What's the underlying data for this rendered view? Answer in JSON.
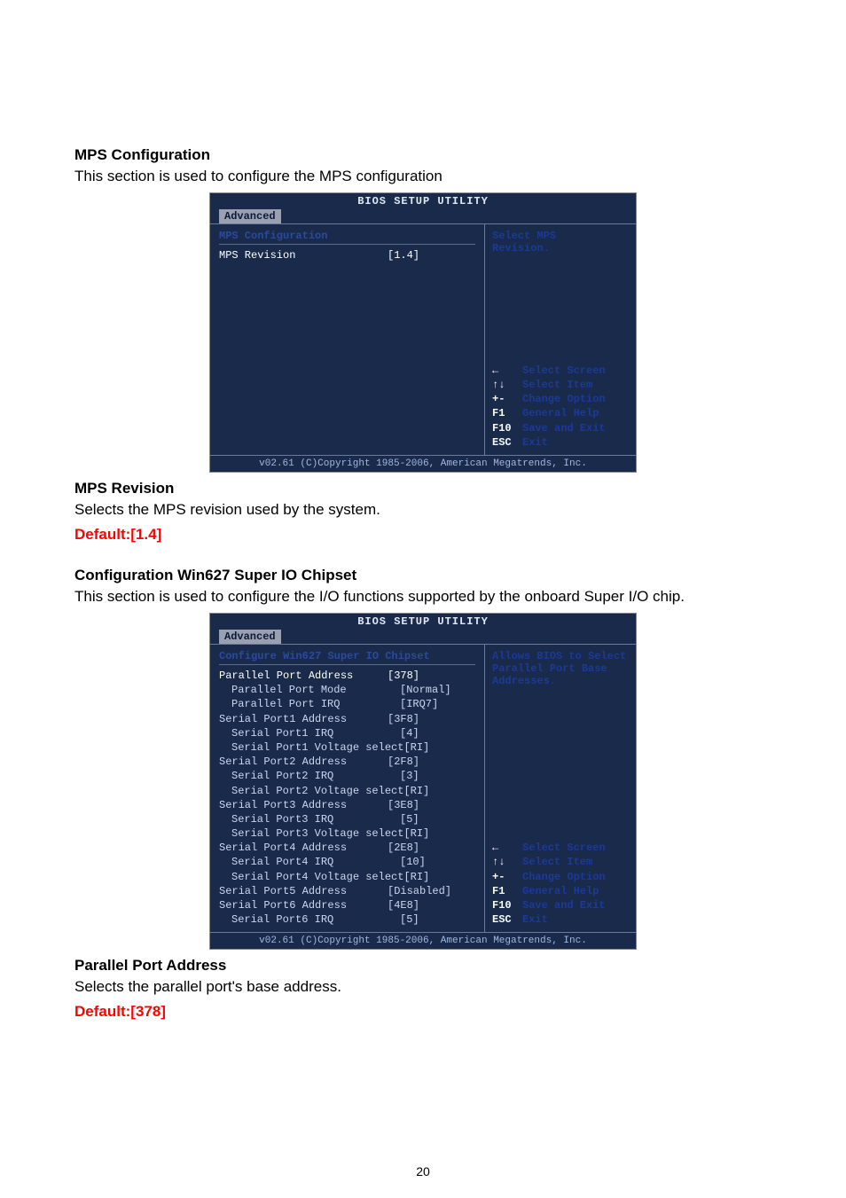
{
  "sec1": {
    "heading": "MPS Configuration",
    "intro": "This section is used to configure the MPS configuration",
    "subheading": "MPS Revision",
    "subtext": "Selects the MPS revision used by the system.",
    "default": "Default:[1.4]"
  },
  "sec2": {
    "heading": "Configuration Win627 Super IO Chipset",
    "intro": "This section is used to configure the I/O functions supported by the onboard Super I/O chip.",
    "subheading": "Parallel Port Address",
    "subtext": "Selects the parallel port's base address.",
    "default": "Default:[378]"
  },
  "bios_common": {
    "title": "BIOS SETUP UTILITY",
    "tab": "Advanced",
    "footer": "v02.61 (C)Copyright 1985-2006, American Megatrends, Inc.",
    "keys": [
      {
        "k": "←",
        "d": "Select Screen"
      },
      {
        "k": "↑↓",
        "d": "Select Item"
      },
      {
        "k": "+-",
        "d": "Change Option"
      },
      {
        "k": "F1",
        "d": "General Help"
      },
      {
        "k": "F10",
        "d": "Save and Exit"
      },
      {
        "k": "ESC",
        "d": "Exit"
      }
    ]
  },
  "bios1": {
    "section_title": "MPS Configuration",
    "row_label": "MPS Revision",
    "row_value": "[1.4]",
    "right_help_l1": "Select MPS",
    "right_help_l2": "Revision."
  },
  "bios2": {
    "section_title": "Configure Win627 Super IO Chipset",
    "rows": [
      {
        "lbl": "Parallel Port Address",
        "val": "[378]",
        "hi": true,
        "indent": false
      },
      {
        "lbl": "Parallel Port Mode",
        "val": "[Normal]",
        "indent": true
      },
      {
        "lbl": "Parallel Port IRQ",
        "val": "[IRQ7]",
        "indent": true
      },
      {
        "lbl": "Serial Port1 Address",
        "val": "[3F8]",
        "indent": false
      },
      {
        "lbl": "Serial Port1 IRQ",
        "val": "[4]",
        "indent": true
      },
      {
        "lbl": "Serial Port1 Voltage select",
        "val": "[RI]",
        "indent": true
      },
      {
        "lbl": "Serial Port2 Address",
        "val": "[2F8]",
        "indent": false
      },
      {
        "lbl": "Serial Port2 IRQ",
        "val": "[3]",
        "indent": true
      },
      {
        "lbl": "Serial Port2 Voltage select",
        "val": "[RI]",
        "indent": true
      },
      {
        "lbl": "Serial Port3 Address",
        "val": "[3E8]",
        "indent": false
      },
      {
        "lbl": "Serial Port3 IRQ",
        "val": "[5]",
        "indent": true
      },
      {
        "lbl": "Serial Port3 Voltage select",
        "val": "[RI]",
        "indent": true
      },
      {
        "lbl": "Serial Port4 Address",
        "val": "[2E8]",
        "indent": false
      },
      {
        "lbl": "Serial Port4 IRQ",
        "val": "[10]",
        "indent": true
      },
      {
        "lbl": "Serial Port4 Voltage select",
        "val": "[RI]",
        "indent": true
      },
      {
        "lbl": "Serial Port5 Address",
        "val": "[Disabled]",
        "indent": false
      },
      {
        "lbl": "Serial Port6 Address",
        "val": "[4E8]",
        "indent": false
      },
      {
        "lbl": "Serial Port6 IRQ",
        "val": "[5]",
        "indent": true
      }
    ],
    "right_help_l1": "Allows BIOS to Select",
    "right_help_l2": "Parallel Port Base",
    "right_help_l3": "Addresses."
  },
  "page_number": "20"
}
